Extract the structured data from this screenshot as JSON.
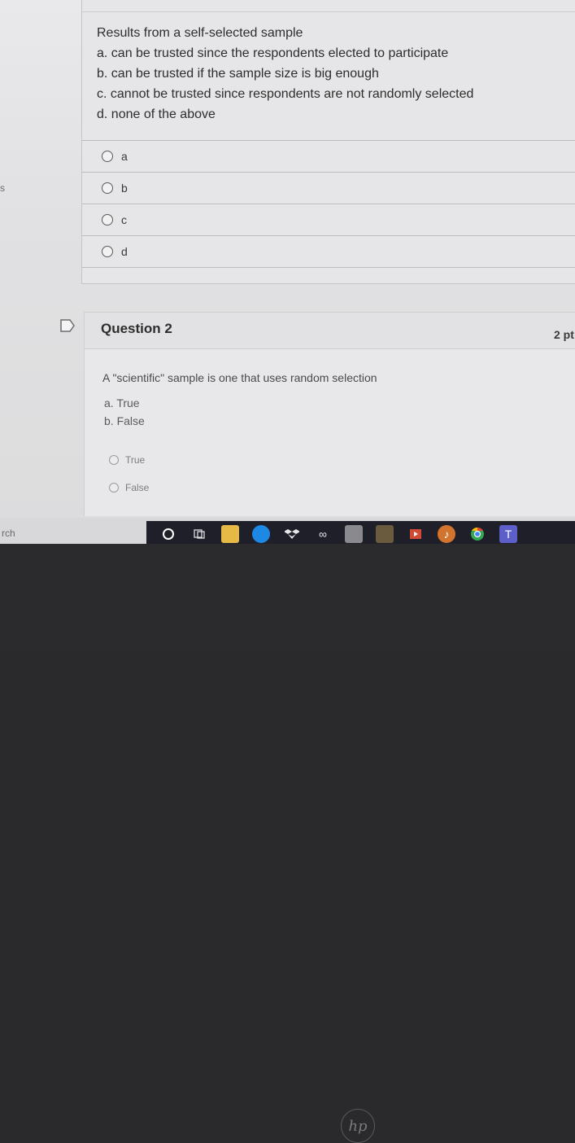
{
  "left_margin_mark": "s",
  "question1": {
    "lines": [
      "Results from a self-selected sample",
      "a. can be trusted since the respondents elected to participate",
      "b. can be trusted if the sample size is big enough",
      "c. cannot be trusted since respondents are not randomly selected",
      "d. none of the above"
    ],
    "answers": [
      "a",
      "b",
      "c",
      "d"
    ]
  },
  "question2": {
    "title": "Question 2",
    "points": "2 pt",
    "text": "A \"scientific\" sample is one that uses random selection",
    "options": [
      "a. True",
      "b. False"
    ],
    "answers": [
      "True",
      "False"
    ]
  },
  "taskbar": {
    "search_text": "rch",
    "icons": [
      "cortana-icon",
      "task-view-icon",
      "file-explorer-icon",
      "edge-icon",
      "dropbox-icon",
      "infinity-icon",
      "calculator-icon",
      "store-icon",
      "media-player-icon",
      "music-icon",
      "chrome-icon",
      "teams-icon"
    ]
  },
  "device": {
    "logo": "hp"
  },
  "colors": {
    "edge_blue": "#1e88e5",
    "chrome_green": "#34a853",
    "teams_purple": "#5b5fc7"
  }
}
